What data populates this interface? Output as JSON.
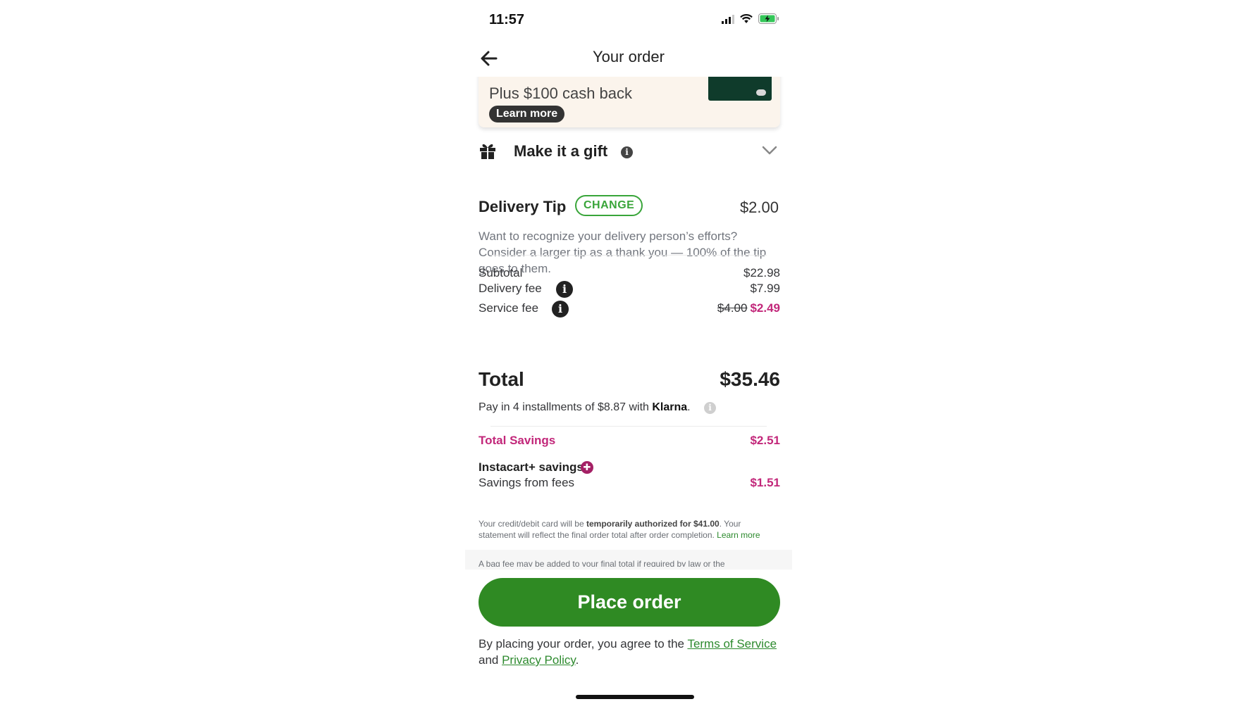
{
  "status_bar": {
    "time": "11:57",
    "signal_icon": "cellular-signal-icon",
    "wifi_icon": "wifi-icon",
    "battery_icon": "battery-charging-icon"
  },
  "header": {
    "title": "Your order",
    "back_icon": "arrow-left-icon"
  },
  "promo": {
    "text": "Plus $100 cash back",
    "learn_more": "Learn more",
    "card_brand": "instacart"
  },
  "gift": {
    "label": "Make it a gift",
    "info": "i"
  },
  "tip": {
    "title": "Delivery Tip",
    "change_label": "CHANGE",
    "amount": "$2.00",
    "description": "Want to recognize your delivery person’s efforts? Consider a larger tip as a thank you — 100% of the tip goes to them."
  },
  "summary": {
    "subtotal_label": "Subtotal",
    "subtotal_value": "$22.98",
    "delivery_label": "Delivery fee",
    "delivery_value": "$7.99",
    "service_label": "Service fee",
    "service_original": "$4.00",
    "service_value": "$2.49",
    "info": "i"
  },
  "total": {
    "label": "Total",
    "value": "$35.46"
  },
  "klarna": {
    "prefix": "Pay in 4 installments of $8.87 with ",
    "brand": "Klarna",
    "suffix": ".",
    "info": "i"
  },
  "savings": {
    "total_label": "Total Savings",
    "total_value": "$2.51",
    "instacart_label": "Instacart+ savings",
    "fees_label": "Savings from fees",
    "fees_value": "$1.51"
  },
  "fineprint": {
    "part1": "Your credit/debit card will be ",
    "bold": "temporarily authorized for $41.00",
    "part2": ". Your statement will reflect the final order total after order completion. ",
    "link": "Learn more",
    "bag_fee": "A bag fee may be added to your final total if required by law or the"
  },
  "place_order": {
    "label": "Place order"
  },
  "agreement": {
    "prefix": "By placing your order, you agree to the ",
    "terms": "Terms of Service",
    "middle": " and ",
    "privacy": "Privacy Policy",
    "suffix": "."
  },
  "colors": {
    "brand_green": "#2f8a23",
    "savings_pink": "#c2277a",
    "change_green": "#39a53a"
  }
}
